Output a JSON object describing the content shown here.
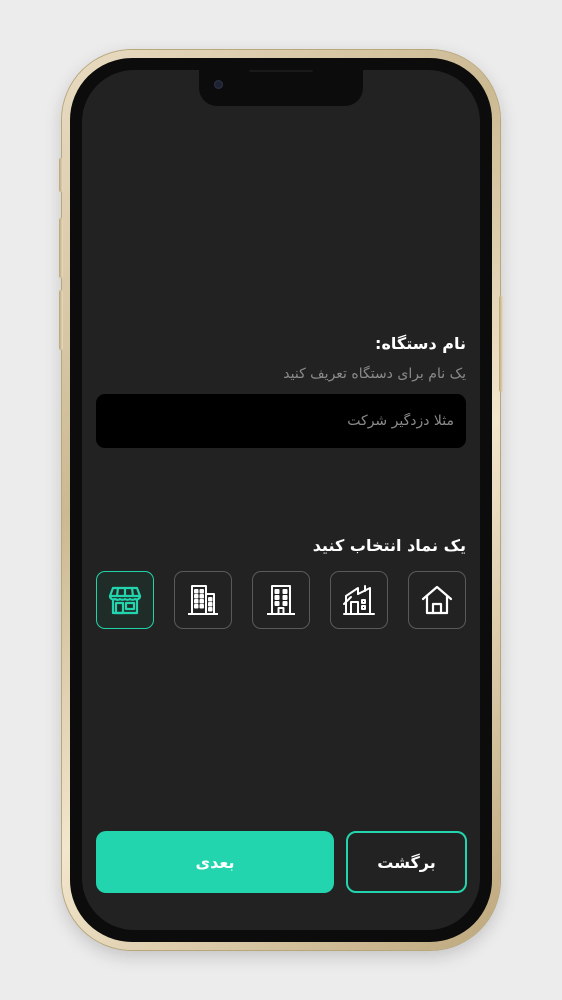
{
  "form": {
    "name_title": "نام دستگاه:",
    "name_subtitle": "یک نام برای دستگاه تعریف کنید",
    "name_placeholder": "مثلا دزدگیر شرکت",
    "name_value": "",
    "symbol_title": "یک نماد انتخاب کنید"
  },
  "symbols": {
    "items": [
      "house-icon",
      "factory-icon",
      "office-building-icon",
      "apartment-building-icon",
      "store-icon"
    ],
    "selected": "store-icon"
  },
  "actions": {
    "next_label": "بعدی",
    "back_label": "برگشت"
  },
  "colors": {
    "accent": "#22d5ae",
    "screen_bg": "#222222",
    "input_bg": "#000000"
  }
}
